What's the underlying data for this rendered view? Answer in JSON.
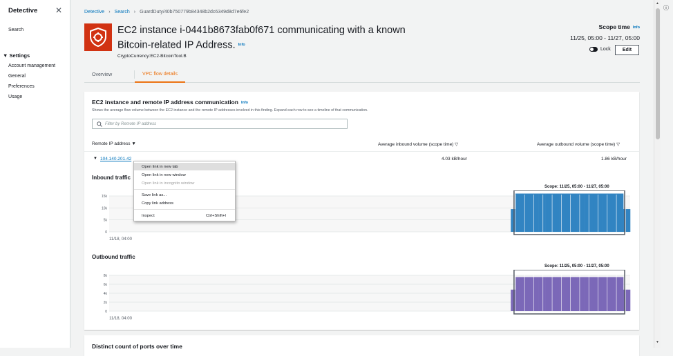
{
  "sidebar": {
    "title": "Detective",
    "search": "Search",
    "settings_section": "Settings",
    "items": [
      "Account management",
      "General",
      "Preferences",
      "Usage"
    ]
  },
  "breadcrumb": [
    "Detective",
    "Search",
    "GuardDuty/40b750779b84348b2dc6349d8d7e6fe2"
  ],
  "finding": {
    "title": "EC2 instance i-0441b8673fab0f671 communicating with a known Bitcoin-related IP Address.",
    "info": "Info",
    "subtitle": "CryptoCurrency:EC2-BitcoinTool.B",
    "severity_color": "#d13212"
  },
  "scope": {
    "title": "Scope time",
    "info": "Info",
    "range": "11/25, 05:00 - 11/27, 05:00",
    "lock_label": "Lock",
    "edit_label": "Edit"
  },
  "tabs": [
    "Overview",
    "VPC flow details"
  ],
  "active_tab": "VPC flow details",
  "panel": {
    "title": "EC2 instance and remote IP address communication",
    "info": "Info",
    "description": "Shows the average flow volume between the EC2 instance and the remote IP addresses involved in this finding. Expand each row to see a timeline of that communication.",
    "filter_placeholder": "Filter by Remote IP address",
    "columns": [
      "Remote IP address",
      "Average inbound volume (scope time)",
      "Average outbound volume (scope time)"
    ],
    "rows": [
      {
        "ip": "104.140.201.42",
        "inbound": "4.03 kB/hour",
        "outbound": "1.86 kB/hour"
      }
    ]
  },
  "context_menu": {
    "items": [
      "Open link in new tab",
      "Open link in new window",
      "Open link in incognito window",
      "Save link as...",
      "Copy link address",
      "Inspect"
    ],
    "inspect_shortcut": "Ctrl+Shift+I"
  },
  "inbound_label": "Inbound traffic",
  "outbound_label": "Outbound traffic",
  "next_section_title": "Distinct count of ports over time",
  "chart_data": [
    {
      "type": "bar",
      "title": "Inbound traffic",
      "scope_label": "Scope: 11/25, 05:00 - 11/27, 05:00",
      "x_start_label": "11/18, 04:00",
      "yticks": [
        "15k",
        "10k",
        "5k",
        "0"
      ],
      "ylim": [
        0,
        15000
      ],
      "color": "#3184c2",
      "values": [
        0,
        0,
        0,
        0,
        0,
        0,
        0,
        0,
        0,
        0,
        0,
        0,
        0,
        0,
        0,
        0,
        0,
        0,
        0,
        0,
        0,
        0,
        0,
        0,
        0,
        0,
        0,
        0,
        0,
        0,
        0,
        0,
        0,
        0,
        0,
        0,
        0,
        0,
        0,
        0,
        0,
        0,
        0,
        0,
        0,
        0,
        0,
        0,
        0,
        0,
        0,
        0,
        0,
        0,
        0,
        0,
        0,
        0,
        0,
        0,
        0,
        0,
        0,
        0,
        0,
        0,
        0,
        0,
        0,
        0,
        0,
        0,
        0,
        0,
        0,
        0,
        0,
        0,
        0,
        0,
        0,
        0,
        0,
        0,
        0,
        0,
        0,
        0,
        0,
        0,
        0,
        0,
        0,
        0,
        0,
        0,
        0,
        0,
        0,
        0,
        0,
        0,
        0,
        0,
        0,
        0,
        0,
        0,
        0,
        0,
        0,
        0,
        0,
        0,
        0,
        0,
        0,
        0,
        0,
        0,
        0,
        0,
        0,
        0,
        0,
        0,
        0,
        0,
        0,
        0,
        0,
        0,
        0,
        0,
        0,
        0,
        0,
        0,
        0,
        0,
        0,
        0,
        0,
        0,
        0,
        0,
        0,
        0,
        0,
        0,
        0,
        0,
        0,
        0,
        0,
        0,
        0,
        0,
        0,
        0,
        0,
        0,
        0,
        0,
        0,
        0,
        0,
        0,
        0,
        0,
        0,
        0,
        0,
        0,
        0,
        9500,
        9500,
        16000,
        16000,
        16000,
        16000,
        16000,
        16000,
        16000,
        16000,
        16000,
        16000,
        16000,
        16000,
        16000,
        16000,
        16000,
        16000,
        16000,
        16000,
        16000,
        16000,
        16000,
        16000,
        16000,
        16000,
        16000,
        16000,
        16000,
        16000,
        16000,
        16000,
        16000,
        16000,
        16000,
        16000,
        16000,
        16000,
        16000,
        16000,
        16000,
        16000,
        16000,
        16000,
        16000,
        16000,
        16000,
        16000,
        16000,
        9500,
        9500,
        9500
      ]
    },
    {
      "type": "bar",
      "title": "Outbound traffic",
      "scope_label": "Scope: 11/25, 05:00 - 11/27, 05:00",
      "x_start_label": "11/18, 04:00",
      "yticks": [
        "8k",
        "6k",
        "4k",
        "2k",
        "0"
      ],
      "ylim": [
        0,
        8000
      ],
      "color": "#7b68b8",
      "values": [
        0,
        0,
        0,
        0,
        0,
        0,
        0,
        0,
        0,
        0,
        0,
        0,
        0,
        0,
        0,
        0,
        0,
        0,
        0,
        0,
        0,
        0,
        0,
        0,
        0,
        0,
        0,
        0,
        0,
        0,
        0,
        0,
        0,
        0,
        0,
        0,
        0,
        0,
        0,
        0,
        0,
        0,
        0,
        0,
        0,
        0,
        0,
        0,
        0,
        0,
        0,
        0,
        0,
        0,
        0,
        0,
        0,
        0,
        0,
        0,
        0,
        0,
        0,
        0,
        0,
        0,
        0,
        0,
        0,
        0,
        0,
        0,
        0,
        0,
        0,
        0,
        0,
        0,
        0,
        0,
        0,
        0,
        0,
        0,
        0,
        0,
        0,
        0,
        0,
        0,
        0,
        0,
        0,
        0,
        0,
        0,
        0,
        0,
        0,
        0,
        0,
        0,
        0,
        0,
        0,
        0,
        0,
        0,
        0,
        0,
        0,
        0,
        0,
        0,
        0,
        0,
        0,
        0,
        0,
        0,
        0,
        0,
        0,
        0,
        0,
        0,
        0,
        0,
        0,
        0,
        0,
        0,
        0,
        0,
        0,
        0,
        0,
        0,
        0,
        0,
        0,
        0,
        0,
        0,
        0,
        0,
        0,
        0,
        0,
        0,
        0,
        0,
        0,
        0,
        0,
        0,
        0,
        0,
        0,
        0,
        0,
        0,
        0,
        0,
        0,
        0,
        0,
        0,
        0,
        0,
        0,
        0,
        0,
        0,
        0,
        4800,
        4800,
        7600,
        7600,
        7600,
        7600,
        7600,
        7600,
        7600,
        7600,
        7600,
        7600,
        7600,
        7600,
        7600,
        7600,
        7600,
        7600,
        7600,
        7600,
        7600,
        7600,
        7600,
        7600,
        7600,
        7600,
        7600,
        7600,
        7600,
        7600,
        7600,
        7600,
        7600,
        7600,
        7600,
        7600,
        7600,
        7600,
        7600,
        7600,
        7600,
        7600,
        7600,
        7600,
        7600,
        7600,
        7600,
        7600,
        7600,
        4800,
        4800,
        4800
      ]
    }
  ]
}
